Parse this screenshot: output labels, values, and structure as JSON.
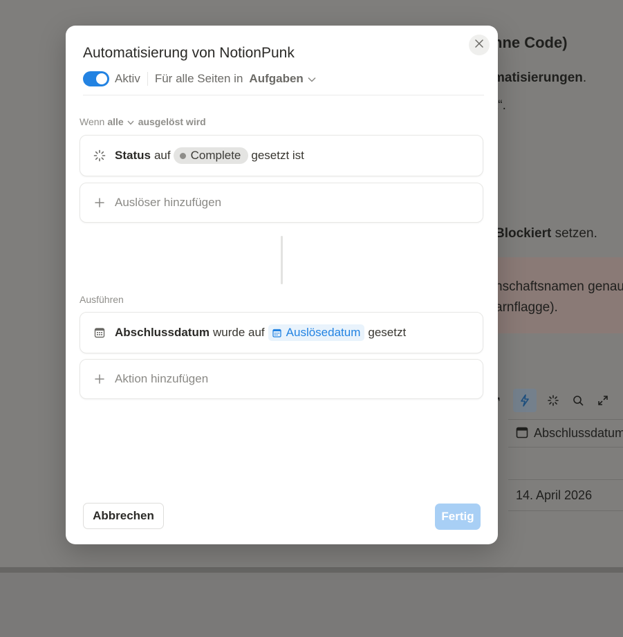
{
  "background": {
    "heading_fragment": "nne Code)",
    "line1_bold": "matisierungen",
    "line1_rest": ".",
    "line2": "t“.",
    "line3_bold": "Blockiert",
    "line3_rest": " setzen.",
    "callout_line1": "nschaftsnamen genau",
    "callout_line2": "arnflagge).",
    "column_header": "Abschlussdatum",
    "date_value": "14. April 2026",
    "toolbar_icons": [
      "arrow-icon",
      "lightning-icon",
      "loader-icon",
      "search-icon",
      "expand-icon",
      "filter-icon"
    ]
  },
  "modal": {
    "title": "Automatisierung von NotionPunk",
    "active_label": "Aktiv",
    "scope_label": "Für alle Seiten in",
    "database": "Aufgaben",
    "trigger_section": {
      "prefix": "Wenn",
      "mode": "alle",
      "suffix": "ausgelöst wird"
    },
    "trigger": {
      "property": "Status",
      "word_auf": "auf",
      "value": "Complete",
      "suffix": "gesetzt ist"
    },
    "add_trigger": "Auslöser hinzufügen",
    "actions_section": "Ausführen",
    "action": {
      "property": "Abschlussdatum",
      "middle": "wurde auf",
      "value": "Auslösedatum",
      "suffix": "gesetzt"
    },
    "add_action": "Aktion hinzufügen",
    "cancel_label": "Abbrechen",
    "done_label": "Fertig"
  },
  "colors": {
    "accent": "#2383e2",
    "done_disabled": "#a8cff5"
  }
}
